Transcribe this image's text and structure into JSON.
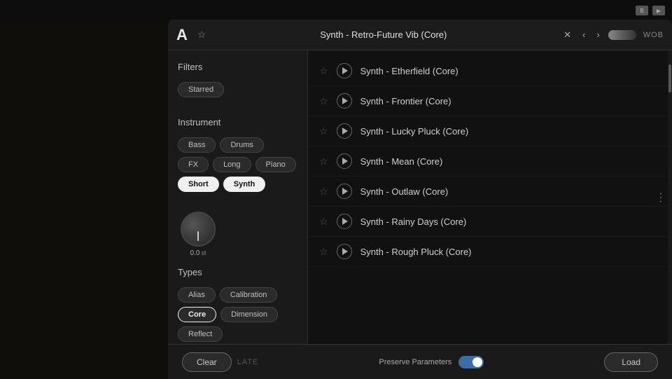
{
  "header": {
    "title_letter": "A",
    "title": "Synth - Retro-Future Vib (Core)",
    "wob": "WOB",
    "controls": [
      "✕",
      "‹",
      "›"
    ]
  },
  "filters": {
    "section_label": "Filters",
    "starred_btn": "Starred",
    "instrument_label": "Instrument",
    "instrument_buttons": [
      {
        "label": "Bass",
        "active": false
      },
      {
        "label": "Drums",
        "active": false
      },
      {
        "label": "FX",
        "active": false
      },
      {
        "label": "Long",
        "active": false
      },
      {
        "label": "Piano",
        "active": false
      },
      {
        "label": "Short",
        "active": true
      },
      {
        "label": "Synth",
        "active": true
      }
    ],
    "types_label": "Types",
    "type_buttons": [
      {
        "label": "Alias",
        "active": false
      },
      {
        "label": "Calibration",
        "active": false
      },
      {
        "label": "Core",
        "active": true
      },
      {
        "label": "Dimension",
        "active": false
      },
      {
        "label": "Reflect",
        "active": false
      }
    ]
  },
  "knob": {
    "value": "0.0",
    "unit": "st"
  },
  "presets": [
    {
      "name": "Synth - Etherfield (Core)",
      "starred": false
    },
    {
      "name": "Synth - Frontier (Core)",
      "starred": false
    },
    {
      "name": "Synth - Lucky Pluck (Core)",
      "starred": false
    },
    {
      "name": "Synth - Mean (Core)",
      "starred": false
    },
    {
      "name": "Synth - Outlaw (Core)",
      "starred": false
    },
    {
      "name": "Synth - Rainy Days (Core)",
      "starred": false
    },
    {
      "name": "Synth - Rough Pluck (Core)",
      "starred": false
    }
  ],
  "bottom": {
    "clear_label": "Clear",
    "late_label": "LATE",
    "preserve_label": "Preserve Parameters",
    "load_label": "Load"
  }
}
